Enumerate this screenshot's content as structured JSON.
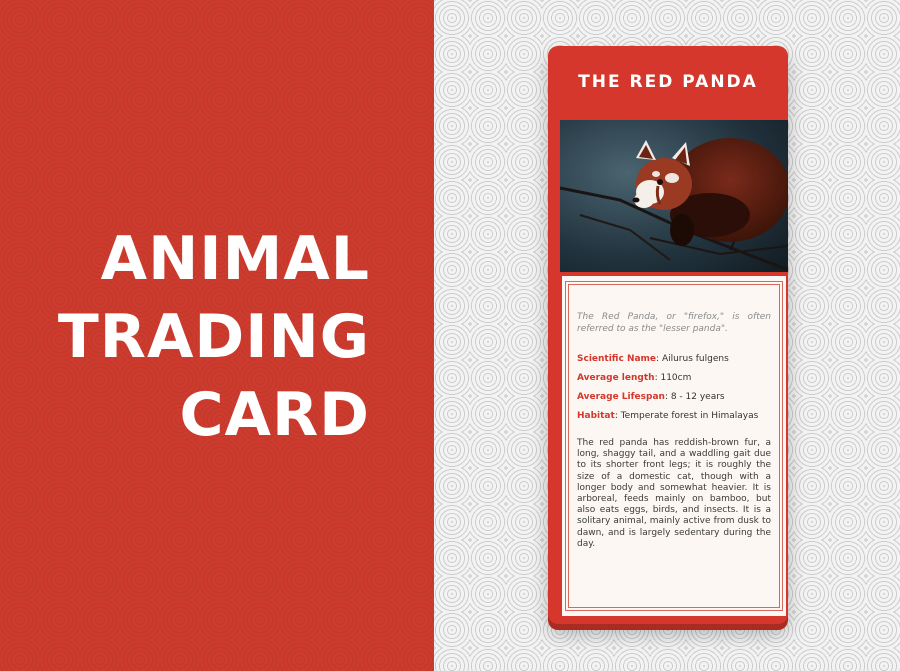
{
  "headline": {
    "line1": "ANIMAL",
    "line2": "TRADING",
    "line3": "CARD"
  },
  "card": {
    "title": "THE RED PANDA",
    "intro": "The Red Panda, or \"firefox,\" is often referred to as the \"lesser panda\".",
    "facts": [
      {
        "label": "Scientific Name",
        "value": "Ailurus fulgens"
      },
      {
        "label": "Average length",
        "value": "110cm"
      },
      {
        "label": "Average Lifespan",
        "value": "8 - 12 years"
      },
      {
        "label": "Habitat",
        "value": "Temperate forest in Himalayas"
      }
    ],
    "description": "The red panda has reddish-brown fur, a long, shaggy tail, and a waddling gait due to its shorter front legs; it is roughly the size of a domestic cat, though with a longer body and somewhat heavier. It is arboreal, feeds mainly on bamboo, but also eats eggs, birds, and insects. It is a solitary animal, mainly active from dusk to dawn, and is largely sedentary during the day."
  },
  "colors": {
    "brand_red": "#cc3b2e",
    "card_red": "#d5372c",
    "label_red": "#d5372c"
  }
}
